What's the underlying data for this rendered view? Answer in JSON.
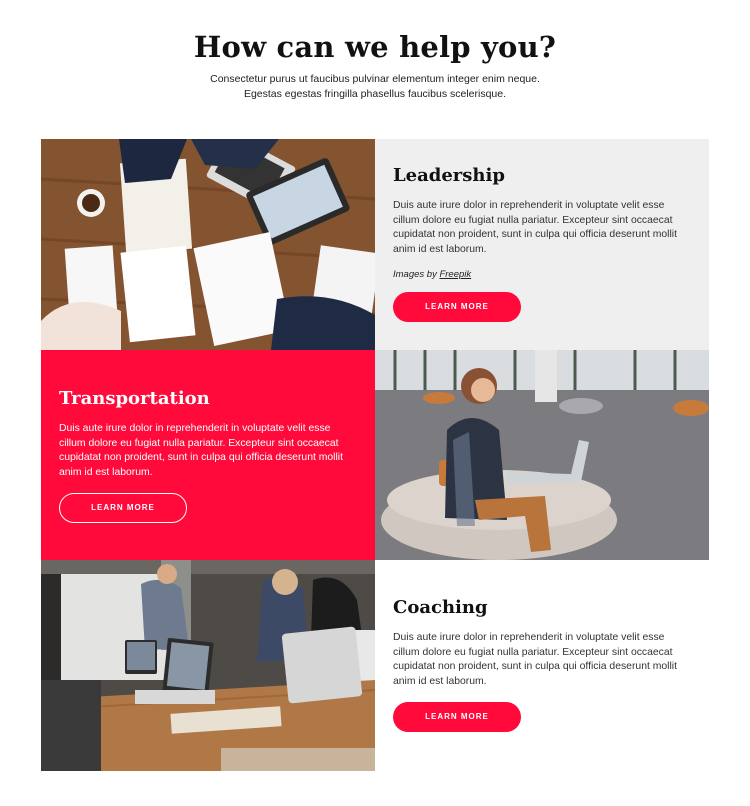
{
  "header": {
    "title": "How can we help you?",
    "subtitle_line1": "Consectetur purus ut faucibus pulvinar elementum integer enim neque.",
    "subtitle_line2": "Egestas egestas fringilla phasellus faucibus scelerisque."
  },
  "cards": [
    {
      "title": "Leadership",
      "description": "Duis aute irure dolor in reprehenderit in voluptate velit esse cillum dolore eu fugiat nulla pariatur. Excepteur sint occaecat cupidatat non proident, sunt in culpa qui officia deserunt mollit anim id est laborum.",
      "credit_prefix": "Images by ",
      "credit_link": "Freepik",
      "button": "LEARN MORE"
    },
    {
      "title": "Transportation",
      "description": "Duis aute irure dolor in reprehenderit in voluptate velit esse cillum dolore eu fugiat nulla pariatur. Excepteur sint occaecat cupidatat non proident, sunt in culpa qui officia deserunt mollit anim id est laborum.",
      "button": "LEARN MORE"
    },
    {
      "title": "Coaching",
      "description": "Duis aute irure dolor in reprehenderit in voluptate velit esse cillum dolore eu fugiat nulla pariatur. Excepteur sint occaecat cupidatat non proident, sunt in culpa qui officia deserunt mollit anim id est laborum.",
      "button": "LEARN MORE"
    }
  ],
  "colors": {
    "accent": "#ff0a3b",
    "panel_grey": "#efefef"
  }
}
